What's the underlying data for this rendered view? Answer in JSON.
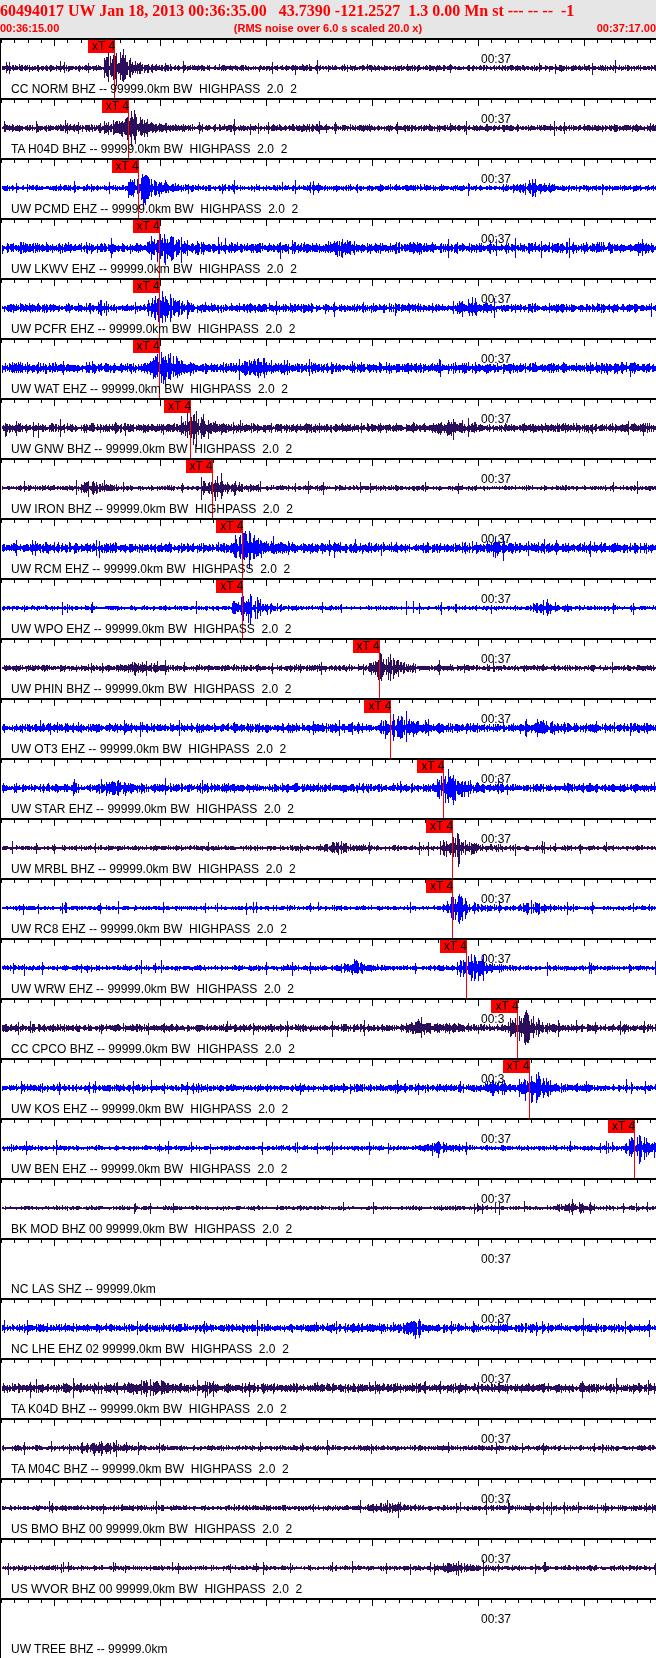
{
  "header": {
    "title": "60494017 UW Jan 18, 2013 00:36:35.00   43.7390 -121.2527  1.3 0.00 Mn st --- -- --  -1",
    "start_time": "00:36:15.00",
    "note": "(RMS noise over 6.0 s scaled 20.0 x)",
    "end_time": "00:37:17.00"
  },
  "traces": [
    {
      "kind": "waveform",
      "color": "#2b0f5c",
      "label": "CC NORM BHZ -- 99999.0km BW  HIGHPASS  2.0  2",
      "time_mark": "00:37",
      "pick": {
        "label": "xT 4",
        "level": 0.174
      }
    },
    {
      "kind": "waveform",
      "color": "#2b0f5c",
      "label": "TA H04D BHZ -- 99999.0km BW  HIGHPASS  2.0  2",
      "time_mark": "00:37",
      "pick": {
        "label": "xT 4",
        "level": 0.195
      }
    },
    {
      "kind": "waveform",
      "color": "#0000ff",
      "label": "UW PCMD EHZ -- 99999.0km BW  HIGHPASS  2.0  2",
      "time_mark": "00:37",
      "pick": {
        "label": "xT 4",
        "level": 0.21
      }
    },
    {
      "kind": "waveform",
      "color": "#0000ff",
      "label": "UW LKWV EHZ -- 99999.0km BW  HIGHPASS  2.0  2",
      "time_mark": "00:37",
      "pick": {
        "label": "xT 4",
        "level": 0.242
      }
    },
    {
      "kind": "waveform",
      "color": "#0000ff",
      "label": "UW PCFR EHZ -- 99999.0km BW  HIGHPASS  2.0  2",
      "time_mark": "00:37",
      "pick": {
        "label": "xT 4",
        "level": 0.242
      }
    },
    {
      "kind": "waveform",
      "color": "#0000ff",
      "label": "UW WAT EHZ -- 99999.0km BW  HIGHPASS  2.0  2",
      "time_mark": "00:37",
      "pick": {
        "label": "xT 4",
        "level": 0.242
      }
    },
    {
      "kind": "waveform",
      "color": "#2b0f5c",
      "label": "UW GNW BHZ -- 99999.0km BW  HIGHPASS  2.0  2",
      "time_mark": "00:37",
      "pick": {
        "label": "xT 4",
        "level": 0.29
      }
    },
    {
      "kind": "waveform",
      "color": "#2b0f5c",
      "label": "UW IRON BHZ -- 99999.0km BW  HIGHPASS  2.0  2",
      "time_mark": "00:37",
      "pick": {
        "label": "xT 4",
        "level": 0.323
      }
    },
    {
      "kind": "waveform",
      "color": "#0000ff",
      "label": "UW RCM EHZ -- 99999.0km BW  HIGHPASS  2.0  2",
      "time_mark": "00:37",
      "pick": {
        "label": "xT 4",
        "level": 0.37
      }
    },
    {
      "kind": "waveform",
      "color": "#0000ff",
      "label": "UW WPO EHZ -- 99999.0km BW  HIGHPASS  2.0  2",
      "time_mark": "00:37",
      "pick": {
        "label": "xT 4",
        "level": 0.37
      }
    },
    {
      "kind": "waveform",
      "color": "#2b0f5c",
      "label": "UW PHIN BHZ -- 99999.0km BW  HIGHPASS  2.0  2",
      "time_mark": "00:37",
      "pick": {
        "label": "xT 4",
        "level": 0.578
      }
    },
    {
      "kind": "waveform",
      "color": "#0000ff",
      "label": "UW OT3 EHZ -- 99999.0km BW  HIGHPASS  2.0  2",
      "time_mark": "00:37",
      "pick": {
        "label": "xT 4",
        "level": 0.596
      }
    },
    {
      "kind": "waveform",
      "color": "#0000ff",
      "label": "UW STAR EHZ -- 99999.0km BW  HIGHPASS  2.0  2",
      "time_mark": "00:37",
      "pick": {
        "label": "xT 4",
        "level": 0.677
      }
    },
    {
      "kind": "waveform",
      "color": "#2b0f5c",
      "label": "UW MRBL BHZ -- 99999.0km BW  HIGHPASS  2.0  2",
      "time_mark": "00:37",
      "pick": {
        "label": "xT 4",
        "level": 0.69
      }
    },
    {
      "kind": "waveform",
      "color": "#0000ff",
      "label": "UW RC8 EHZ -- 99999.0km BW  HIGHPASS  2.0  2",
      "time_mark": "00:37",
      "pick": {
        "label": "xT 4",
        "level": 0.69
      }
    },
    {
      "kind": "waveform",
      "color": "#0000ff",
      "label": "UW WRW EHZ -- 99999.0km BW  HIGHPASS  2.0  2",
      "time_mark": "00:37",
      "pick": {
        "label": "xT 4",
        "level": 0.711
      }
    },
    {
      "kind": "waveform",
      "color": "#2b0f5c",
      "label": "CC CPCO BHZ -- 99999.0km BW  HIGHPASS  2.0  2",
      "time_mark": "00:3",
      "pick": {
        "label": "xT 4",
        "level": 0.79
      }
    },
    {
      "kind": "waveform",
      "color": "#0000ff",
      "label": "UW KOS EHZ -- 99999.0km BW  HIGHPASS  2.0  2",
      "time_mark": "00:3",
      "pick": {
        "label": "xT 4",
        "level": 0.807
      }
    },
    {
      "kind": "waveform",
      "color": "#0000ff",
      "label": "UW BEN EHZ -- 99999.0km BW  HIGHPASS  2.0  2",
      "time_mark": "00:37",
      "pick": {
        "label": "xT 4",
        "level": 0.968
      }
    },
    {
      "kind": "waveform",
      "color": "#2b0f5c",
      "label": "BK MOD BHZ 00 99999.0km BW  HIGHPASS  2.0  2",
      "time_mark": "00:37"
    },
    {
      "kind": "blank",
      "label": "NC LAS SHZ -- 99999.0km",
      "time_mark": "00:37"
    },
    {
      "kind": "waveform",
      "color": "#0000ff",
      "label": "NC LHE EHZ 02 99999.0km BW  HIGHPASS  2.0  2",
      "time_mark": "00:37"
    },
    {
      "kind": "waveform",
      "color": "#2b0f5c",
      "label": "TA K04D BHZ -- 99999.0km BW  HIGHPASS  2.0  2",
      "time_mark": "00:37"
    },
    {
      "kind": "waveform",
      "color": "#2b0f5c",
      "label": "TA M04C BHZ -- 99999.0km BW  HIGHPASS  2.0  2",
      "time_mark": "00:37"
    },
    {
      "kind": "waveform",
      "color": "#2b0f5c",
      "label": "US BMO BHZ 00 99999.0km BW  HIGHPASS  2.0  2",
      "time_mark": "00:37"
    },
    {
      "kind": "waveform",
      "color": "#2b0f5c",
      "label": "US WVOR BHZ 00 99999.0km BW  HIGHPASS  2.0  2",
      "time_mark": "00:37"
    },
    {
      "kind": "blank",
      "label": "UW TREE BHZ -- 99999.0km",
      "time_mark": "00:37"
    }
  ]
}
